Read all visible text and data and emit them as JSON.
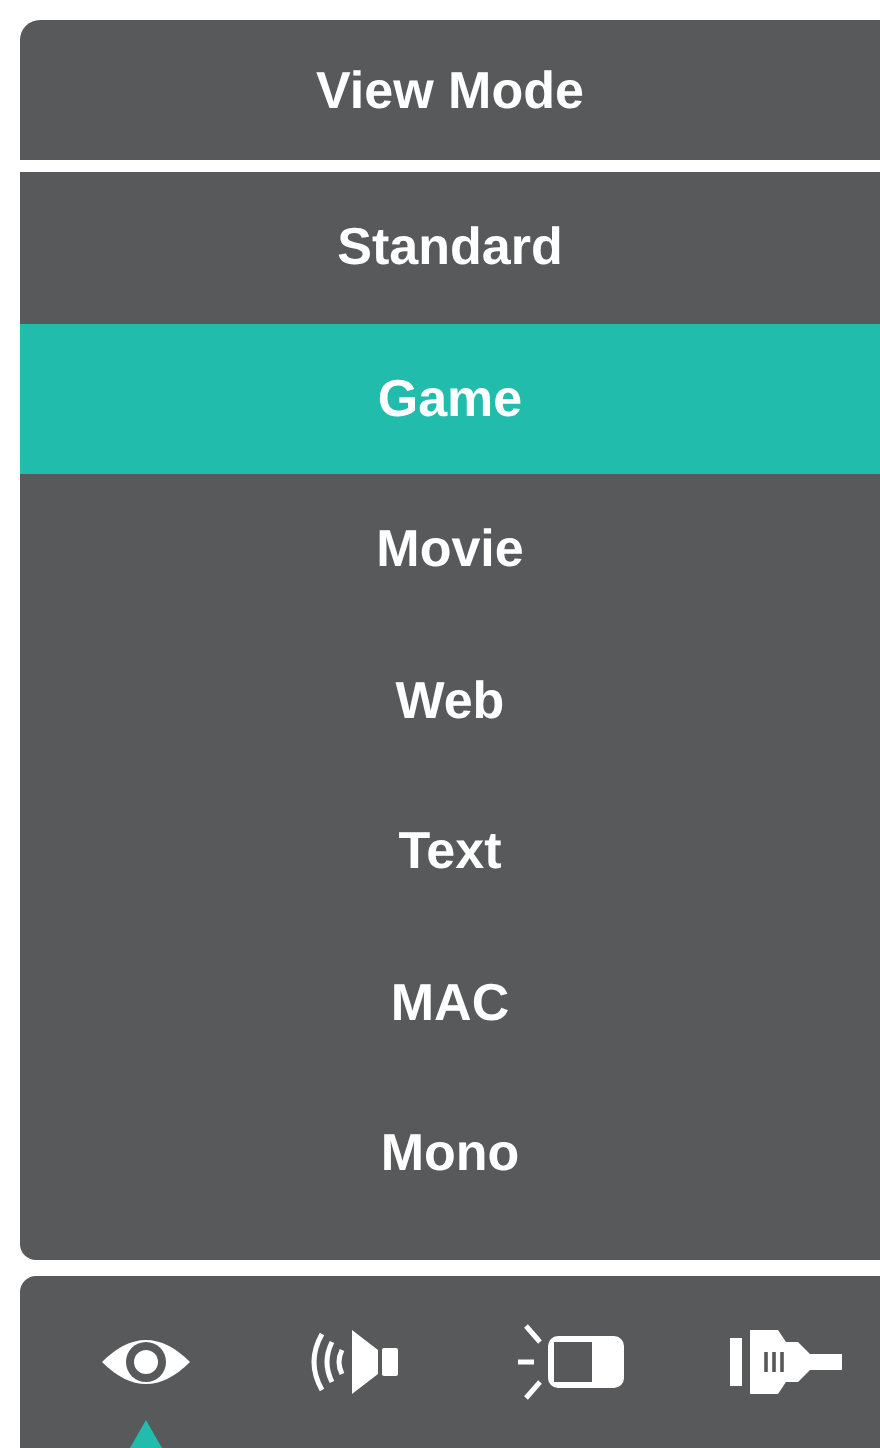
{
  "header": {
    "title": "View Mode"
  },
  "modes": [
    {
      "label": "Standard",
      "selected": false
    },
    {
      "label": "Game",
      "selected": true
    },
    {
      "label": "Movie",
      "selected": false
    },
    {
      "label": "Web",
      "selected": false
    },
    {
      "label": "Text",
      "selected": false
    },
    {
      "label": "MAC",
      "selected": false
    },
    {
      "label": "Mono",
      "selected": false
    }
  ],
  "toolbar": [
    {
      "kind": "eye",
      "selected": true
    },
    {
      "kind": "speaker",
      "selected": false
    },
    {
      "kind": "light",
      "selected": false
    },
    {
      "kind": "plug",
      "selected": false
    }
  ]
}
